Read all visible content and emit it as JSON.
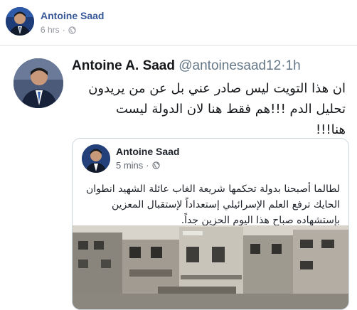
{
  "post": {
    "author_name": "Antoine Saad",
    "timestamp": "6 hrs",
    "separator": "·",
    "privacy_icon": "globe-icon"
  },
  "tweet": {
    "name": "Antoine A. Saad",
    "handle": "@antoinesaad12",
    "dot": "·",
    "time": "1h",
    "lines": [
      "ان هذا التويت ليس صادر عني بل عن من يريدون",
      "تحليل الدم !!!هم فقط هنا لان الدولة ليست",
      "هنا!!!"
    ]
  },
  "embedded_post": {
    "author_name": "Antoine Saad",
    "time": "5 mins",
    "separator": "·",
    "privacy_icon": "globe-icon",
    "lines": [
      "لطالما أصبحنا بدولة تحكمها شريعة الغاب عائلة الشهيد انطوان",
      "الحايك ترفع العلم الإسرائيلي إستعداداً لإستقبال المعزين",
      "بإستشهاده صباح هذا اليوم الحزين جداً."
    ]
  },
  "colors": {
    "link_blue": "#365899",
    "meta_gray": "#90949c",
    "handle_gray": "#657786",
    "border": "#ccd6dd"
  }
}
